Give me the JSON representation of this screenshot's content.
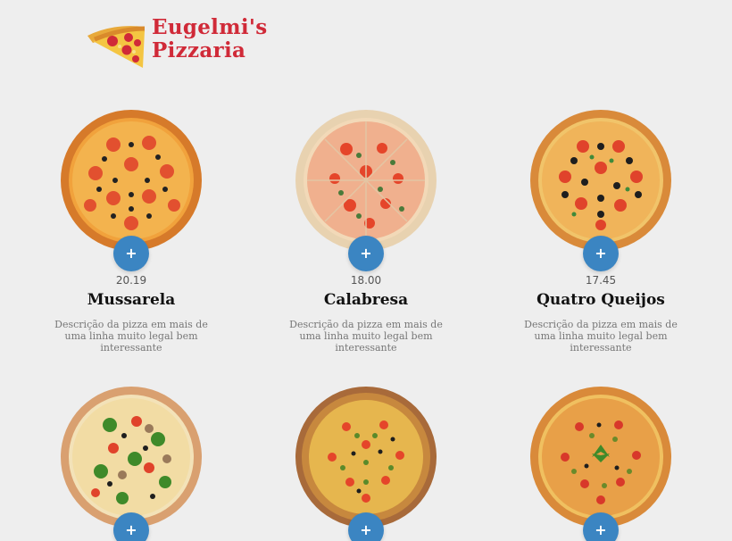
{
  "brand": {
    "line1": "Eugelmi's",
    "line2": "Pizzaria",
    "logo_icon": "pizza-slice-icon",
    "color": "#d02a38"
  },
  "menu": {
    "add_label": "+",
    "button_color": "#3b85c2",
    "items": [
      {
        "name": "Mussarela",
        "price": "20.19",
        "description": "Descrição da pizza em mais de uma linha muito legal bem interessante"
      },
      {
        "name": "Calabresa",
        "price": "18.00",
        "description": "Descrição da pizza em mais de uma linha muito legal bem interessante"
      },
      {
        "name": "Quatro Queijos",
        "price": "17.45",
        "description": "Descrição da pizza em mais de uma linha muito legal bem interessante"
      },
      {
        "name": "",
        "price": "",
        "description": ""
      },
      {
        "name": "",
        "price": "",
        "description": ""
      },
      {
        "name": "",
        "price": "",
        "description": ""
      }
    ]
  }
}
